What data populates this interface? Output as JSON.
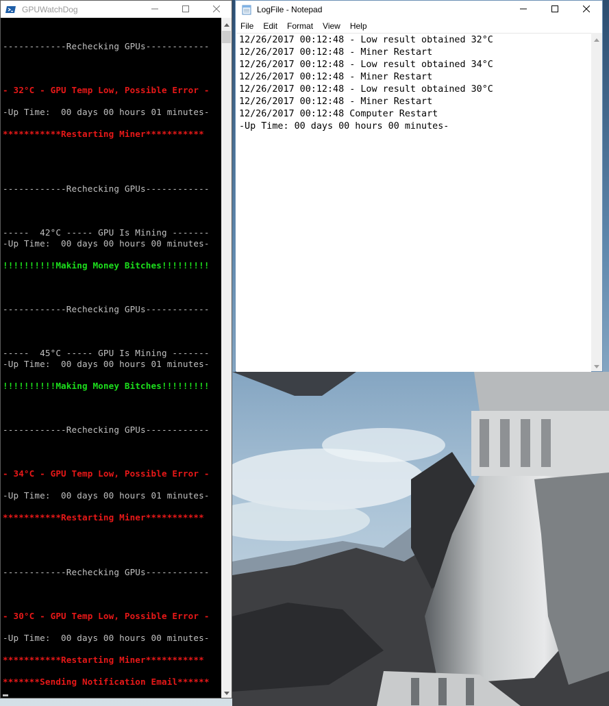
{
  "console": {
    "title": "GPUWatchDog",
    "lines": [
      {
        "text": "------------Rechecking GPUs------------",
        "color": "grey"
      },
      {
        "text": "- 32°C - GPU Temp Low, Possible Error -",
        "color": "red"
      },
      {
        "text": "-Up Time:  00 days 00 hours 01 minutes-",
        "color": "grey"
      },
      {
        "text": "***********Restarting Miner***********",
        "color": "red"
      },
      {
        "text": "------------Rechecking GPUs------------",
        "color": "grey"
      },
      {
        "text": "-----  42°C ----- GPU Is Mining -------",
        "color": "grey"
      },
      {
        "text": "-Up Time:  00 days 00 hours 00 minutes-",
        "color": "grey"
      },
      {
        "text": "!!!!!!!!!!Making Money Bitches!!!!!!!!!",
        "color": "green"
      },
      {
        "text": "------------Rechecking GPUs------------",
        "color": "grey"
      },
      {
        "text": "-----  45°C ----- GPU Is Mining -------",
        "color": "grey"
      },
      {
        "text": "-Up Time:  00 days 00 hours 01 minutes-",
        "color": "grey"
      },
      {
        "text": "!!!!!!!!!!Making Money Bitches!!!!!!!!!",
        "color": "green"
      },
      {
        "text": "------------Rechecking GPUs------------",
        "color": "grey"
      },
      {
        "text": "- 34°C - GPU Temp Low, Possible Error -",
        "color": "red"
      },
      {
        "text": "-Up Time:  00 days 00 hours 01 minutes-",
        "color": "grey"
      },
      {
        "text": "***********Restarting Miner***********",
        "color": "red"
      },
      {
        "text": "------------Rechecking GPUs------------",
        "color": "grey"
      },
      {
        "text": "- 30°C - GPU Temp Low, Possible Error -",
        "color": "red"
      },
      {
        "text": "-Up Time:  00 days 00 hours 00 minutes-",
        "color": "grey"
      },
      {
        "text": "***********Restarting Miner***********",
        "color": "red"
      },
      {
        "text": "*******Sending Notification Email******",
        "color": "red"
      }
    ]
  },
  "notepad": {
    "title": "LogFile - Notepad",
    "menu": [
      "File",
      "Edit",
      "Format",
      "View",
      "Help"
    ],
    "lines": [
      "12/26/2017 00:12:48 - Low result obtained 32°C",
      "12/26/2017 00:12:48 - Miner Restart",
      "12/26/2017 00:12:48 - Low result obtained 34°C",
      "12/26/2017 00:12:48 - Miner Restart",
      "12/26/2017 00:12:48 - Low result obtained 30°C",
      "12/26/2017 00:12:48 - Miner Restart",
      "12/26/2017 00:12:48 Computer Restart",
      "-Up Time: 00 days 00 hours 00 minutes-"
    ]
  },
  "colors": {
    "console_red": "#e81818",
    "console_green": "#1cdf1c",
    "console_grey": "#c0c0c0",
    "notepad_border": "#6a8fb3"
  },
  "icons": {
    "console_app": "powershell-icon",
    "notepad_app": "notepad-icon",
    "minimize": "minimize-icon",
    "maximize": "maximize-icon",
    "close": "close-icon"
  }
}
